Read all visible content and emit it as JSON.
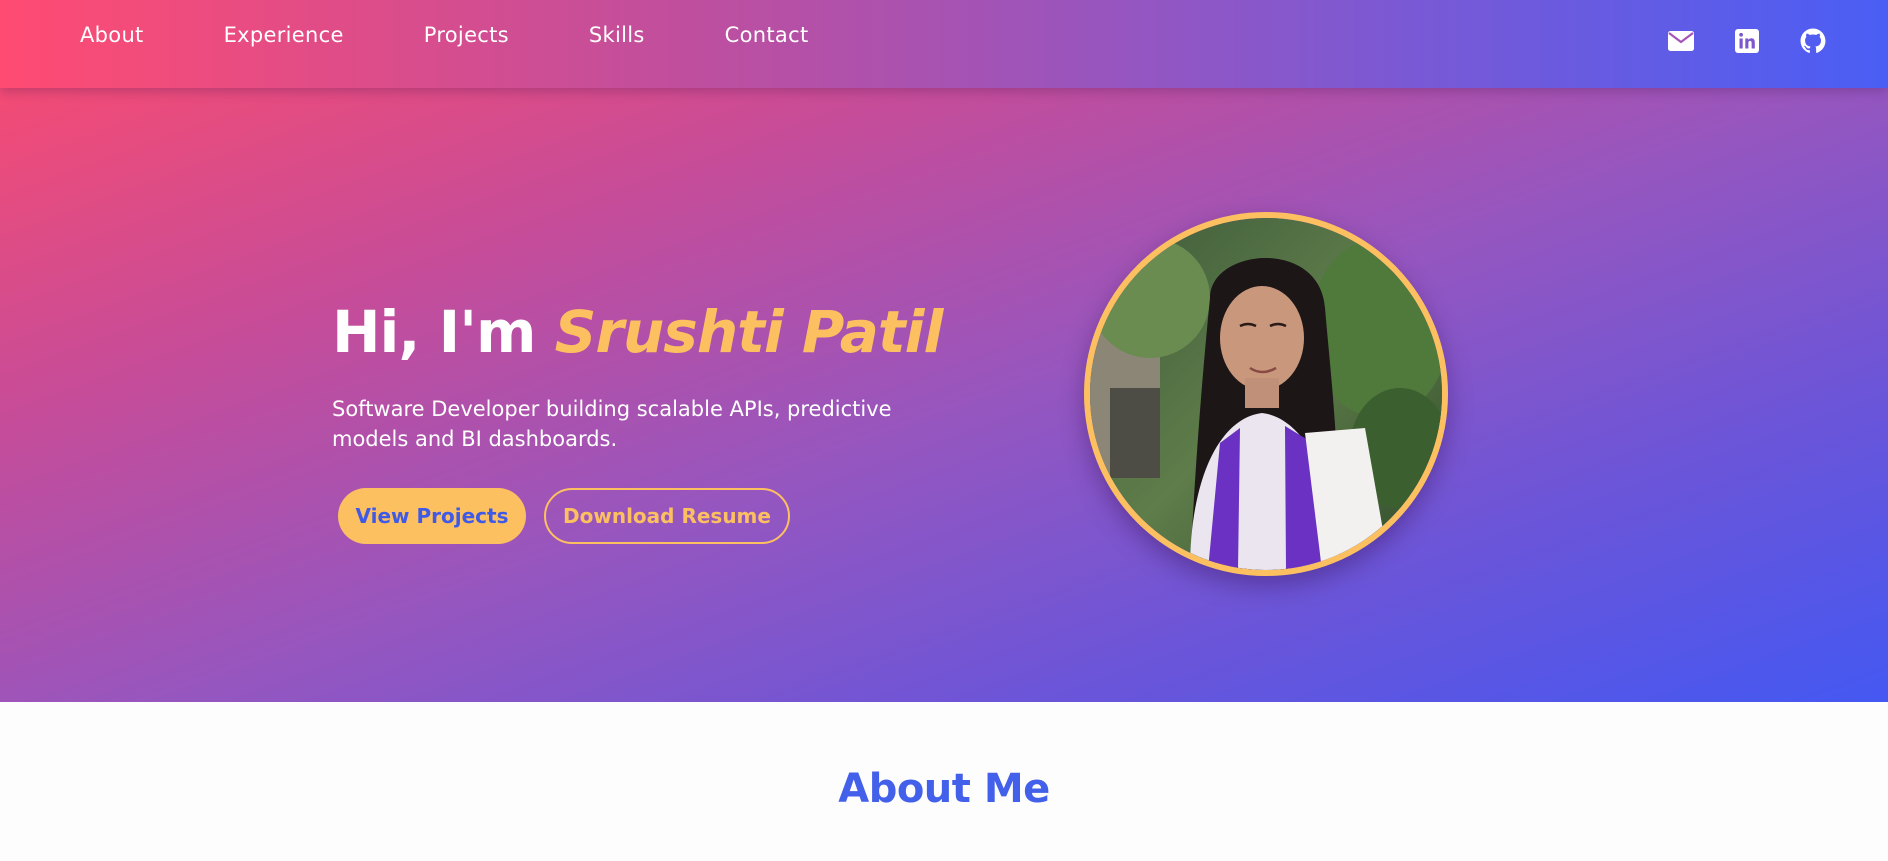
{
  "nav": {
    "links": [
      {
        "label": "About"
      },
      {
        "label": "Experience"
      },
      {
        "label": "Projects"
      },
      {
        "label": "Skills"
      },
      {
        "label": "Contact"
      }
    ],
    "icons": [
      "mail-icon",
      "linkedin-icon",
      "github-icon"
    ]
  },
  "hero": {
    "greeting": "Hi, I'm ",
    "name": "Srushti Patil",
    "subtitle": "Software Developer building scalable APIs, predictive models and BI dashboards.",
    "primary_button": "View Projects",
    "secondary_button": "Download Resume"
  },
  "about": {
    "title": "About Me"
  },
  "colors": {
    "accent": "#fdc060",
    "brand_blue": "#4360ea",
    "gradient_start": "#ff4b6b",
    "gradient_end": "#4458f2"
  }
}
